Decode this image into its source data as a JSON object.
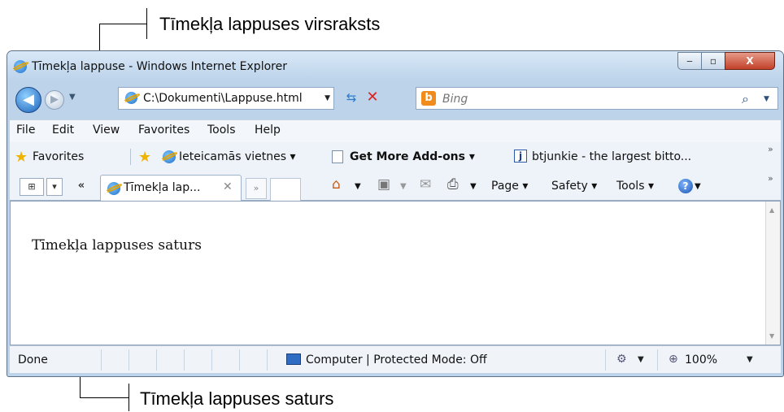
{
  "annotations": {
    "title_label": "Tīmekļa lappuses virsraksts",
    "content_label": "Tīmekļa lappuses saturs"
  },
  "window": {
    "title": "Tīmekļa lappuse - Windows Internet Explorer",
    "controls": {
      "minimize": "‒",
      "maximize": "▫",
      "close": "X"
    }
  },
  "navbar": {
    "back": "◀",
    "forward": "▶",
    "address": "C:\\Dokumenti\\Lappuse.html",
    "search_placeholder": "Bing",
    "search_logo": "b"
  },
  "menu": [
    "File",
    "Edit",
    "View",
    "Favorites",
    "Tools",
    "Help"
  ],
  "favorites_bar": {
    "favorites_label": "Favorites",
    "items": [
      "Ieteicamās vietnes ▾",
      "Get More Add-ons ▾",
      "btjunkie - the largest bitto..."
    ]
  },
  "tabs": {
    "active_tab_label": "Tīmekļa lap...",
    "tab_close": "✕",
    "new_tab": "»"
  },
  "command_bar": {
    "page": "Page ▾",
    "safety": "Safety ▾",
    "tools": "Tools ▾"
  },
  "content": {
    "text": "Tīmekļa lappuses saturs"
  },
  "status": {
    "left": "Done",
    "mode": "Computer | Protected Mode: Off",
    "zoom": "100%"
  },
  "icons": {
    "browser": "ie-logo",
    "search": "magnifier",
    "home": "house",
    "feeds": "rss",
    "mail": "envelope",
    "print": "printer",
    "help": "question"
  }
}
